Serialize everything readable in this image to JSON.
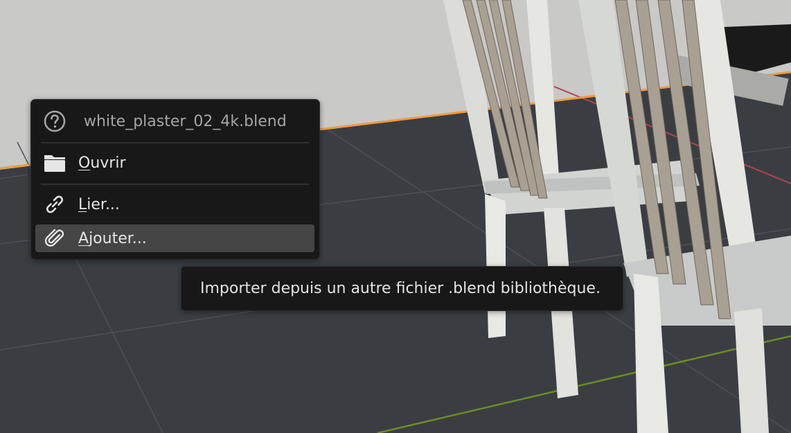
{
  "menu": {
    "header": {
      "icon": "question-icon",
      "title": "white_plaster_02_4k.blend"
    },
    "items": [
      {
        "icon": "folder-icon",
        "mnemonic": "O",
        "rest": "uvrir",
        "active": false
      },
      {
        "icon": "link-icon",
        "mnemonic": "L",
        "rest": "ier...",
        "active": false
      },
      {
        "icon": "paperclip-icon",
        "mnemonic": "A",
        "rest": "jouter...",
        "active": true
      }
    ]
  },
  "tooltip": {
    "text": "Importer depuis un autre fichier .blend bibliothèque."
  },
  "colors": {
    "menu_bg": "#181818",
    "highlight": "#454545",
    "text": "#e6e6e6",
    "muted_text": "#a6a6a6",
    "x_axis": "#b8434f",
    "y_axis": "#6b8e23",
    "selection": "#f39a3c"
  }
}
